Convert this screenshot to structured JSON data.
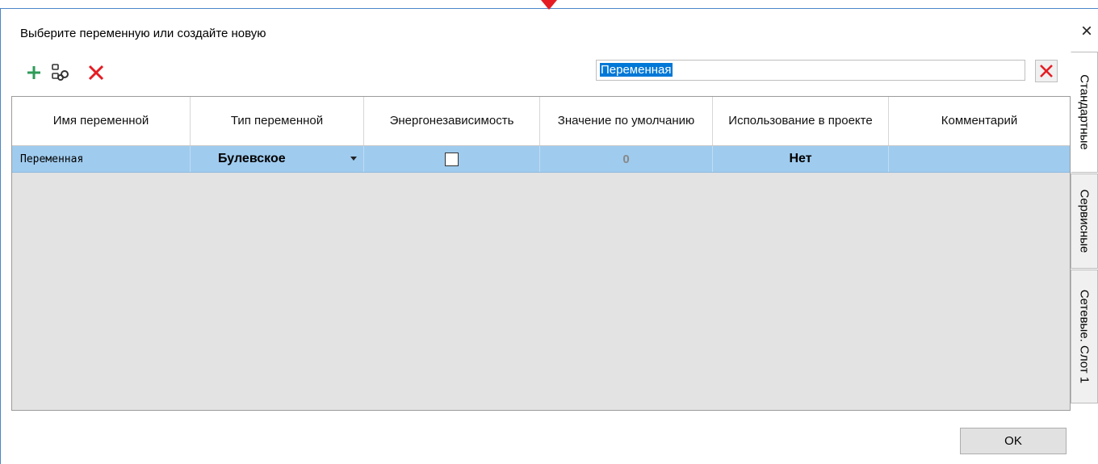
{
  "dialog": {
    "title": "Выберите переменную или создайте новую",
    "close_label": "×"
  },
  "toolbar": {
    "add_icon": "plus-icon",
    "link_icon": "link-variable-icon",
    "delete_icon": "delete-x-icon"
  },
  "search": {
    "value": "Переменная",
    "clear_icon": "clear-x-icon"
  },
  "table": {
    "columns": [
      "Имя переменной",
      "Тип переменной",
      "Энергонезависимость",
      "Значение по умолчанию",
      "Использование в проекте",
      "Комментарий"
    ],
    "rows": [
      {
        "name": "Переменная",
        "type": "Булевское",
        "nonvolatile": false,
        "default": "0",
        "usage": "Нет",
        "comment": ""
      }
    ]
  },
  "tabs": [
    {
      "label": "Стандартные",
      "active": true
    },
    {
      "label": "Сервисные",
      "active": false
    },
    {
      "label": "Сетевые. Слот 1",
      "active": false
    }
  ],
  "buttons": {
    "ok": "OK"
  },
  "colors": {
    "selection_row": "#9fcbee",
    "accent_border": "#4b86c7",
    "delete_red": "#e51c23",
    "add_green": "#2e9b57"
  }
}
